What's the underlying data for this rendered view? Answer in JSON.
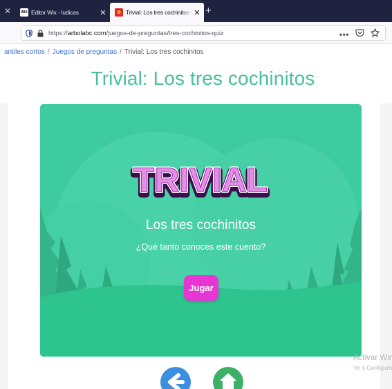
{
  "browser": {
    "tabs": [
      {
        "label": "Editor Wix - ludicas",
        "favicon": "WIX",
        "active": false
      },
      {
        "label": "Trivial: Los tres cochinitos | Árbol ABC",
        "favicon": "ABC",
        "active": true
      }
    ],
    "url": {
      "prefix": "https://",
      "domain": "arbolabc.com",
      "path": "/juegos-de-preguntas/tres-cochinitos-quiz"
    },
    "icons": [
      "shield-icon",
      "lock-icon",
      "more-icon",
      "pocket-icon",
      "bookmark-star-icon",
      "close-icon",
      "new-tab-icon"
    ]
  },
  "breadcrumb": {
    "first": "antiles cortos",
    "second": "Juegos de preguntas",
    "current": "Trivial: Los tres cochinitos",
    "separator": "/"
  },
  "page": {
    "title": "Trivial: Los tres cochinitos"
  },
  "game": {
    "logo_text": "TRIVIAL",
    "title": "Los tres cochinitos",
    "subtitle": "¿Qué tanto conoces este cuento?",
    "play_label": "Jugar",
    "colors": {
      "background": "#3fcba0",
      "play": "#e736d3",
      "logo": "#e48ee9"
    }
  },
  "watermark": {
    "line1": "Activar Windows",
    "line2": "Ve a Configuración"
  },
  "bottom_nav": [
    {
      "name": "back",
      "icon": "arrow-left-icon",
      "color": "#3b8fe0"
    },
    {
      "name": "home",
      "icon": "home-icon",
      "color": "#3cb067"
    }
  ]
}
